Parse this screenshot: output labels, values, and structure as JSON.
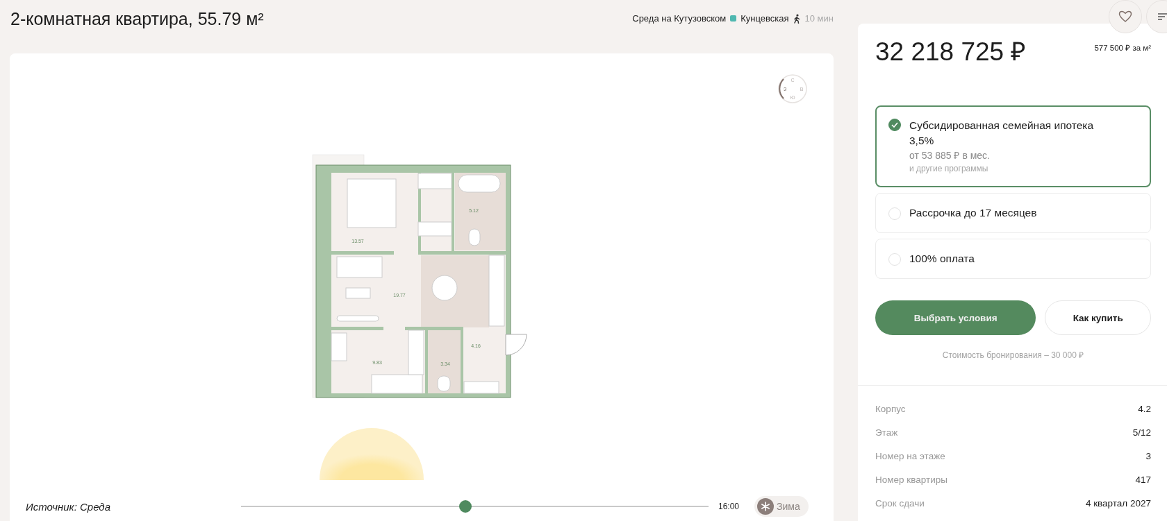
{
  "header": {
    "title": "2-комнатная квартира, 55.79 м²",
    "complex": "Среда на Кутузовском",
    "metro": {
      "name": "Кунцевская",
      "color": "#4fb8b0"
    },
    "walk_time": "10 мин"
  },
  "plan": {
    "compass": [
      "С",
      "В",
      "Ю",
      "З"
    ],
    "room_areas": [
      "13.57",
      "5.12",
      "19.77",
      "4.16",
      "9.83",
      "3.34"
    ]
  },
  "source_note": "Источник: Среда",
  "sun_slider": {
    "level": 0.48,
    "time": "16:00"
  },
  "season_toggle": {
    "label": "Зима"
  },
  "price": {
    "total": "32 218 725 ₽",
    "per_m2": "577 500 ₽ за м²"
  },
  "payment_options": [
    {
      "title": "Субсидированная семейная ипотека 3,5%",
      "monthly": "от 53 885 ₽ в мес.",
      "note": "и другие программы",
      "selected": true
    },
    {
      "title": "Рассрочка до 17 месяцев",
      "selected": false
    },
    {
      "title": "100% оплата",
      "selected": false
    }
  ],
  "buttons": [
    {
      "label": "Выбрать условия",
      "kind": "primary"
    },
    {
      "label": "Как купить",
      "kind": "secondary"
    }
  ],
  "booking_note": "Стоимость бронирования – 30 000 ₽",
  "details": [
    {
      "label": "Корпус",
      "value": "4.2"
    },
    {
      "label": "Этаж",
      "value": "5/12"
    },
    {
      "label": "Номер на этаже",
      "value": "3"
    },
    {
      "label": "Номер квартиры",
      "value": "417"
    },
    {
      "label": "Срок сдачи",
      "value": "4 квартал 2027"
    }
  ]
}
